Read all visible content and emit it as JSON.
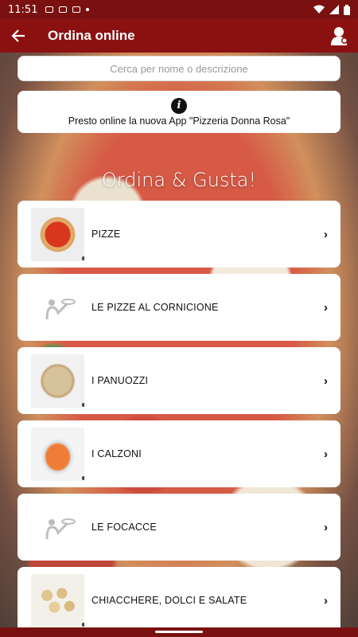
{
  "status": {
    "time": "11:51",
    "icons": [
      "cloud-icon",
      "photo-icon",
      "gamepad-icon",
      "dot-icon"
    ],
    "system_icons": [
      "wifi-icon",
      "signal-icon",
      "battery-icon"
    ]
  },
  "app_bar": {
    "title": "Ordina online",
    "back_icon": "arrow-left-icon",
    "profile_icon": "user-icon"
  },
  "search": {
    "placeholder": "Cerca per nome o descrizione"
  },
  "info": {
    "icon": "info-icon",
    "icon_glyph": "i",
    "text": "Presto online la nuova App \"Pizzeria Donna Rosa\""
  },
  "tagline": "Ordina & Gusta!",
  "categories": [
    {
      "label": "PIZZE",
      "thumb": "pizza"
    },
    {
      "label": "LE PIZZE AL CORNICIONE",
      "thumb": "placeholder"
    },
    {
      "label": "I PANUOZZI",
      "thumb": "panuozzo"
    },
    {
      "label": "I CALZONI",
      "thumb": "calzone"
    },
    {
      "label": "LE FOCACCE",
      "thumb": "placeholder"
    },
    {
      "label": "CHIACCHERE, DOLCI E SALATE",
      "thumb": "chiacchiere"
    }
  ],
  "chevron": "›",
  "colors": {
    "primary": "#8b1111",
    "status_bar": "#7a1010"
  }
}
